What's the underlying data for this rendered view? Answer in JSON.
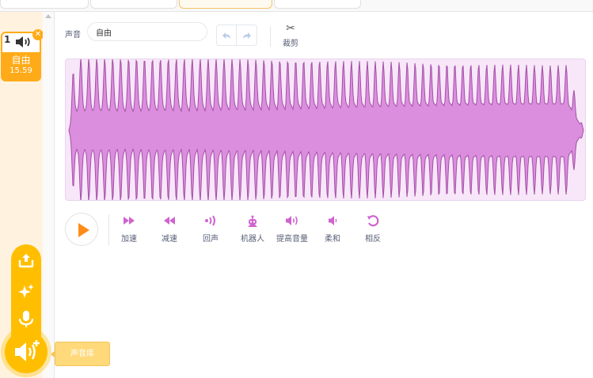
{
  "colors": {
    "accent": "#ffab19",
    "sound_purple": "#cf63cf",
    "wave_fill": "#db8ede",
    "wave_stroke": "#a450a6",
    "wave_bg": "#f7e7f9",
    "fab_yellow": "#ffbf00"
  },
  "sound_list": [
    {
      "index": "1",
      "name": "自由",
      "duration": "15.59",
      "icon": "speaker-icon",
      "delete_icon": "close-icon"
    }
  ],
  "editor": {
    "sound_label": "声音",
    "sound_name": "自由",
    "undo_icon": "undo-icon",
    "redo_icon": "redo-icon",
    "trim_label": "裁剪",
    "trim_icon": "scissors-icon"
  },
  "effects": [
    {
      "label": "加速",
      "icon": "fast-forward-icon"
    },
    {
      "label": "减速",
      "icon": "rewind-icon"
    },
    {
      "label": "回声",
      "icon": "echo-icon"
    },
    {
      "label": "机器人",
      "icon": "robot-icon"
    },
    {
      "label": "提高音量",
      "icon": "louder-icon"
    },
    {
      "label": "柔和",
      "icon": "softer-icon"
    },
    {
      "label": "相反",
      "icon": "reverse-icon"
    }
  ],
  "fab": {
    "items": [
      "upload-icon",
      "sparkle-icon",
      "microphone-icon"
    ],
    "main_icon": "speaker-plus-icon",
    "tooltip": "声音库"
  }
}
